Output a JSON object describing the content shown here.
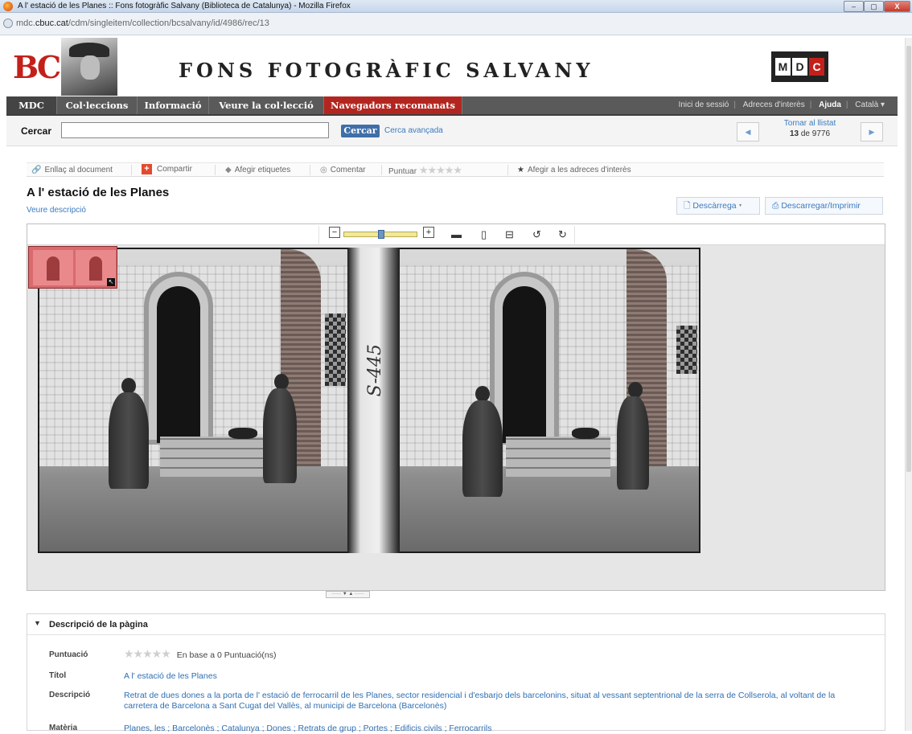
{
  "window": {
    "title": "A l' estació de les Planes :: Fons fotogràfic Salvany (Biblioteca de Catalunya) - Mozilla Firefox",
    "url_prefix": "mdc.",
    "url_domain": "cbuc.cat",
    "url_path": "/cdm/singleitem/collection/bcsalvany/id/4986/rec/13"
  },
  "header": {
    "bc_logo": "BC",
    "site_title": "FONS FOTOGRÀFIC SALVANY",
    "mdc_logo": [
      "M",
      "D",
      "C"
    ]
  },
  "nav": {
    "items": [
      "MDC",
      "Col·leccions",
      "Informació",
      "Veure la col·lecció",
      "Navegadors recomanats"
    ],
    "right": {
      "login": "Inici de sessió",
      "links": "Adreces d'interès",
      "help": "Ajuda",
      "language": "Català ▾"
    }
  },
  "search": {
    "label": "Cercar",
    "value": "",
    "button": "Cercar",
    "advanced": "Cerca avançada",
    "back_to_list": "Tornar al llistat",
    "current": "13",
    "of_text": " de 9776"
  },
  "doc_tools": {
    "link": "Enllaç al document",
    "share": "Compartir",
    "tags": "Afegir etiquetes",
    "comment": "Comentar",
    "rate": "Puntuar",
    "add_fav": "Afegir a les adreces d'interès"
  },
  "document": {
    "title": "A l' estació de les Planes",
    "show_description": "Veure descripció",
    "download": "Descàrrega",
    "download_print": "Descarregar/Imprimir",
    "plate_number": "S-445"
  },
  "zoom": {
    "level": 0.5
  },
  "description": {
    "heading": "Descripció de la pàgina",
    "rating_label": "Puntuació",
    "rating_stars": "★★★★★",
    "rating_text": "En base a 0 Puntuació(ns)",
    "title_label": "Títol",
    "title_value": "A l' estació de les Planes",
    "desc_label": "Descripció",
    "desc_value": "Retrat de dues dones a la porta de l' estació de ferrocarril de les Planes, sector residencial i d'esbarjo dels barcelonins, situat al vessant septentrional de la serra de Collserola, al voltant de la carretera de Barcelona a Sant Cugat del Vallès, al municipi de Barcelona (Barcelonès)",
    "subject_label": "Matèria",
    "subject_value": "Planes, les ; Barcelonès ; Catalunya ; Dones ; Retrats de grup ; Portes ; Edificis civils ; Ferrocarrils"
  },
  "colors": {
    "accent_red": "#b32620",
    "link_blue": "#3b7bbf",
    "nav_gray": "#5a5a5a"
  }
}
